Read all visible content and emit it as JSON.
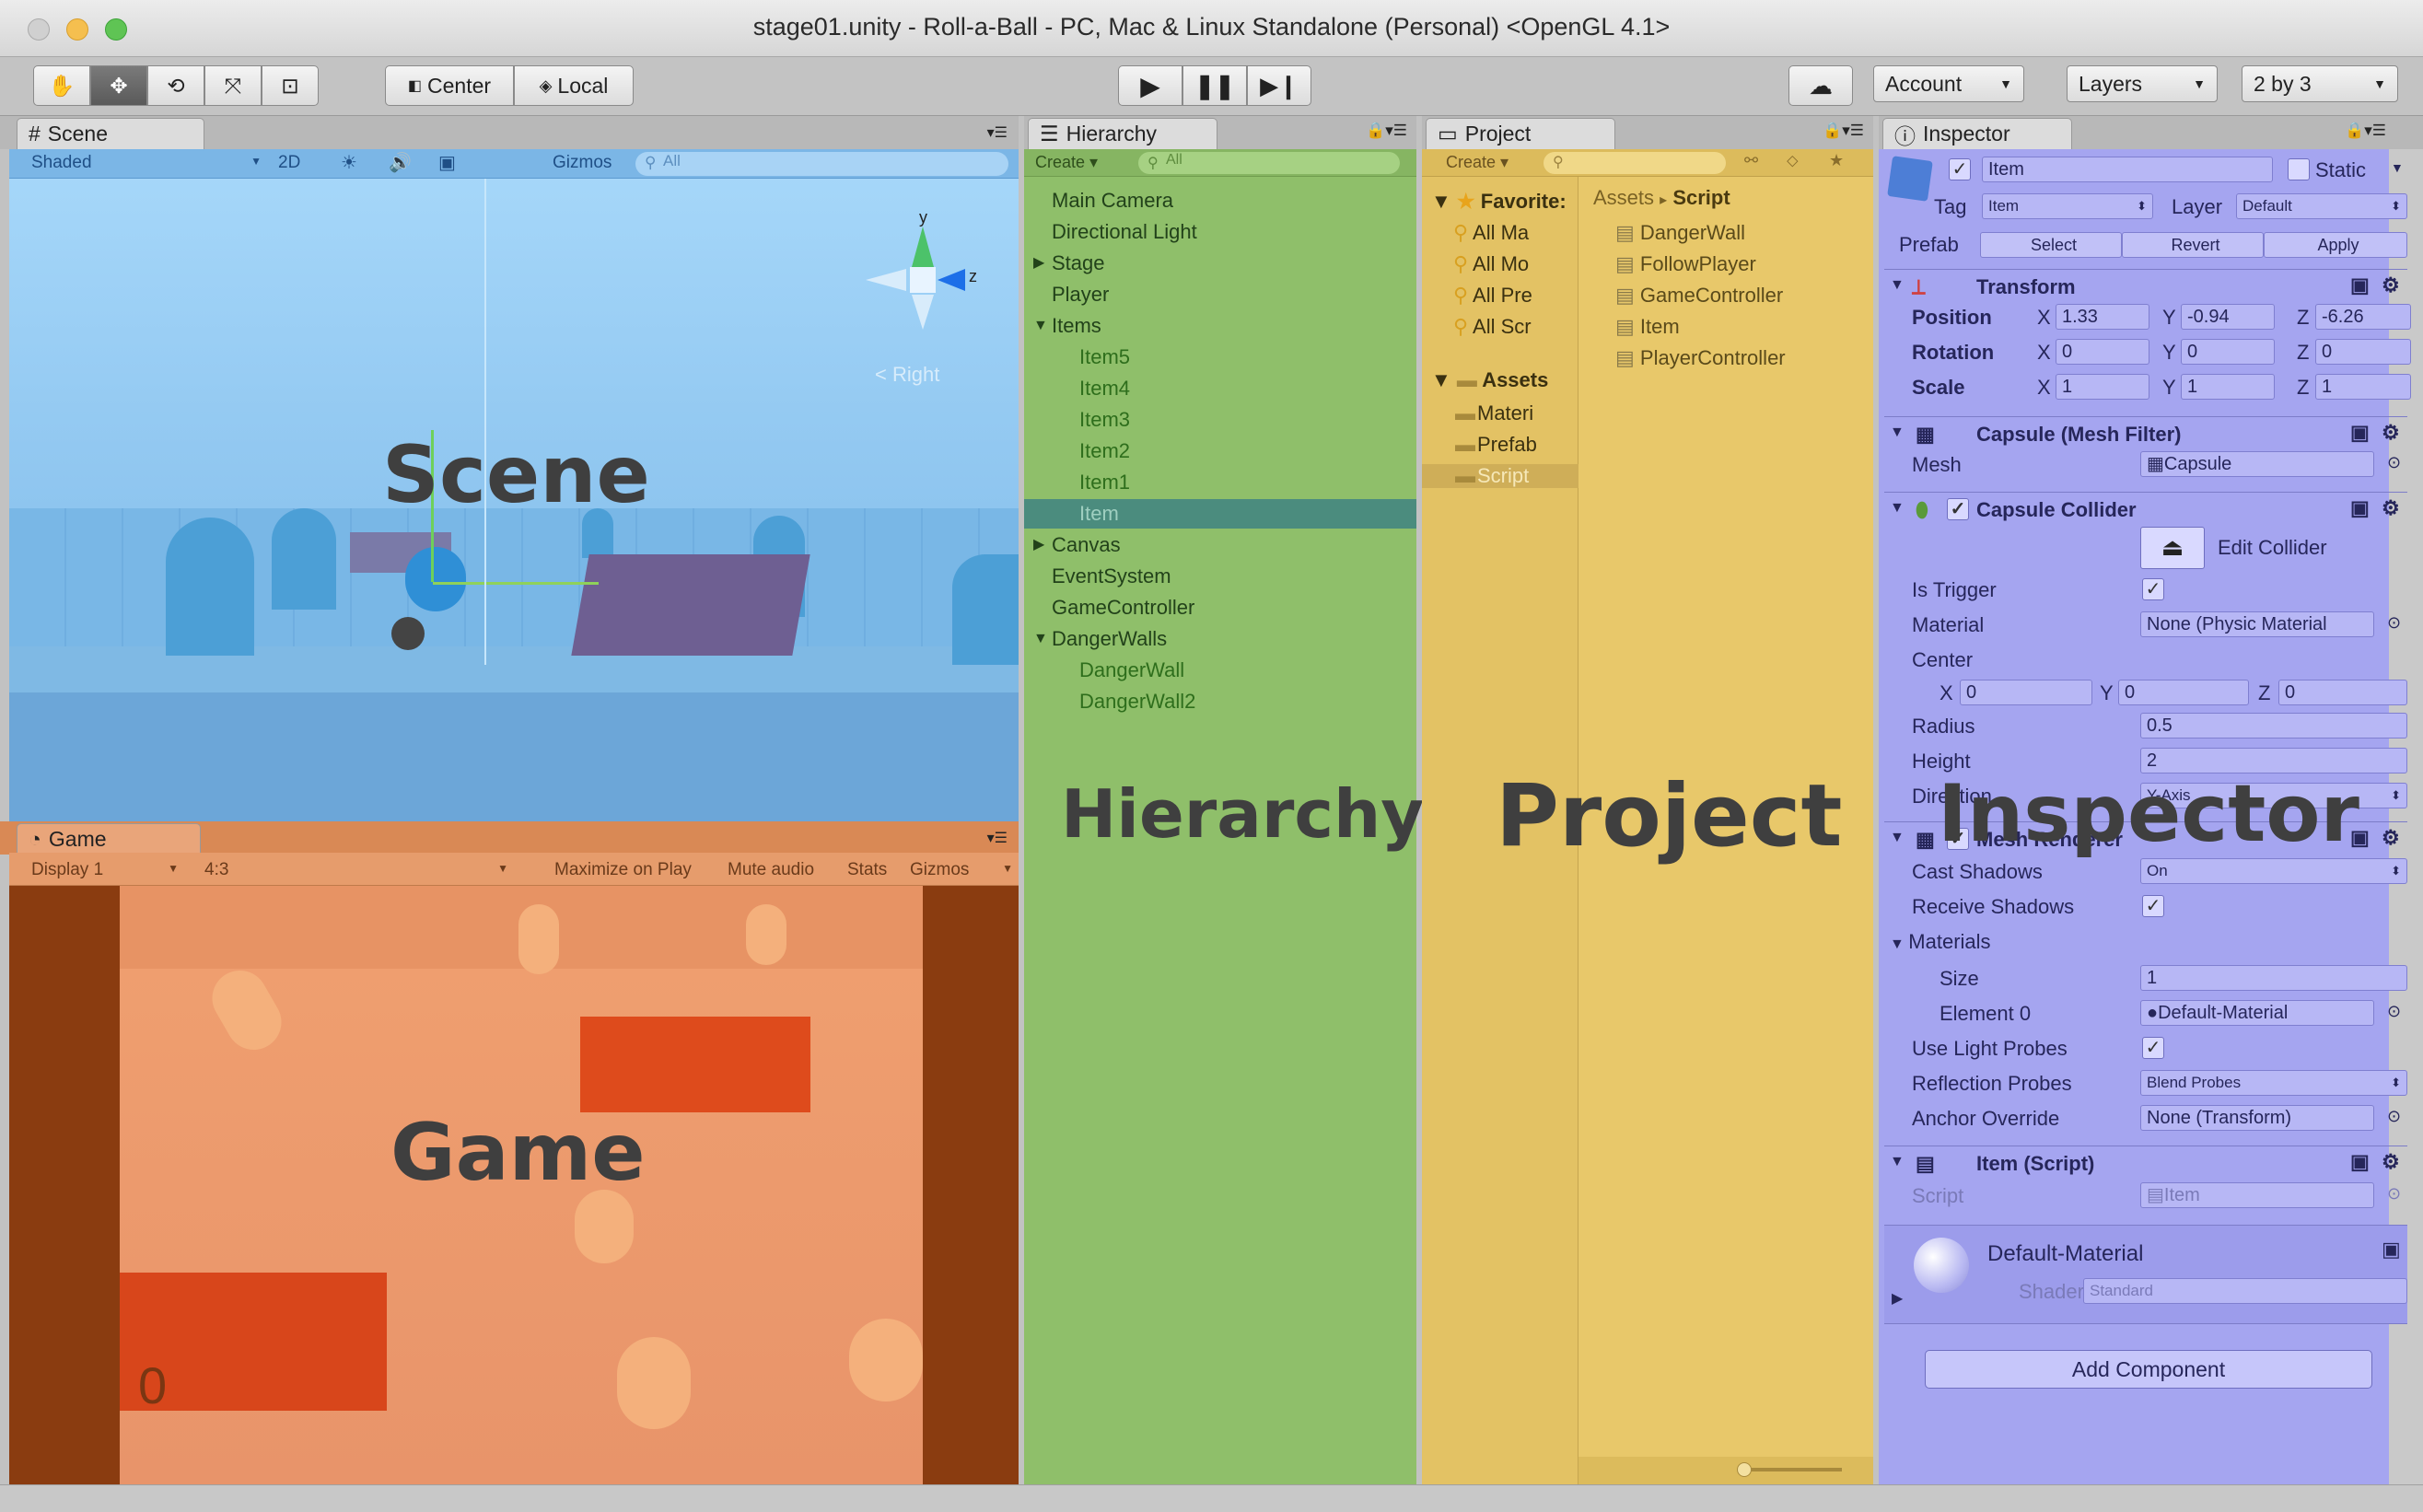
{
  "window": {
    "title": "stage01.unity - Roll-a-Ball - PC, Mac & Linux Standalone (Personal) <OpenGL 4.1>"
  },
  "toolbar": {
    "pivot_label": "Center",
    "space_label": "Local",
    "account_label": "Account",
    "layers_label": "Layers",
    "layout_label": "2 by 3"
  },
  "scene": {
    "tab_label": "Scene",
    "shading": "Shaded",
    "mode_2d": "2D",
    "gizmos": "Gizmos",
    "search_placeholder": "All",
    "gizmo_view": "< Right",
    "axis_y": "y",
    "axis_z": "z",
    "overlay_label": "Scene"
  },
  "game": {
    "tab_label": "Game",
    "display": "Display 1",
    "aspect": "4:3",
    "maximize": "Maximize on Play",
    "mute": "Mute audio",
    "stats": "Stats",
    "gizmos": "Gizmos",
    "score": "0",
    "overlay_label": "Game"
  },
  "hierarchy": {
    "tab_label": "Hierarchy",
    "create_label": "Create",
    "search_placeholder": "All",
    "overlay_label": "Hierarchy",
    "items": [
      {
        "label": "Main Camera",
        "indent": 0,
        "arrow": ""
      },
      {
        "label": "Directional Light",
        "indent": 0,
        "arrow": ""
      },
      {
        "label": "Stage",
        "indent": 0,
        "arrow": "▶"
      },
      {
        "label": "Player",
        "indent": 0,
        "arrow": ""
      },
      {
        "label": "Items",
        "indent": 0,
        "arrow": "▼"
      },
      {
        "label": "Item5",
        "indent": 1,
        "arrow": ""
      },
      {
        "label": "Item4",
        "indent": 1,
        "arrow": ""
      },
      {
        "label": "Item3",
        "indent": 1,
        "arrow": ""
      },
      {
        "label": "Item2",
        "indent": 1,
        "arrow": ""
      },
      {
        "label": "Item1",
        "indent": 1,
        "arrow": ""
      },
      {
        "label": "Item",
        "indent": 1,
        "arrow": "",
        "selected": true
      },
      {
        "label": "Canvas",
        "indent": 0,
        "arrow": "▶"
      },
      {
        "label": "EventSystem",
        "indent": 0,
        "arrow": ""
      },
      {
        "label": "GameController",
        "indent": 0,
        "arrow": ""
      },
      {
        "label": "DangerWalls",
        "indent": 0,
        "arrow": "▼"
      },
      {
        "label": "DangerWall",
        "indent": 1,
        "arrow": ""
      },
      {
        "label": "DangerWall2",
        "indent": 1,
        "arrow": ""
      }
    ]
  },
  "project": {
    "tab_label": "Project",
    "create_label": "Create",
    "overlay_label": "Project",
    "favorites_label": "Favorite:",
    "favorites": [
      "All Ma",
      "All Mo",
      "All Pre",
      "All Scr"
    ],
    "assets_label": "Assets",
    "asset_folders": [
      "Materi",
      "Prefab",
      "Script"
    ],
    "breadcrumb": [
      "Assets",
      "Script"
    ],
    "breadcrumb_sep": "▸",
    "files": [
      "DangerWall",
      "FollowPlayer",
      "GameController",
      "Item",
      "PlayerController"
    ]
  },
  "inspector": {
    "tab_label": "Inspector",
    "overlay_label": "Inspector",
    "object_name": "Item",
    "static_label": "Static",
    "tag_label": "Tag",
    "tag_value": "Item",
    "layer_label": "Layer",
    "layer_value": "Default",
    "prefab_label": "Prefab",
    "prefab_select": "Select",
    "prefab_revert": "Revert",
    "prefab_apply": "Apply",
    "transform": {
      "header": "Transform",
      "position_label": "Position",
      "pos_x": "1.33",
      "pos_y": "-0.94",
      "pos_z": "-6.26",
      "rotation_label": "Rotation",
      "rot_x": "0",
      "rot_y": "0",
      "rot_z": "0",
      "scale_label": "Scale",
      "scl_x": "1",
      "scl_y": "1",
      "scl_z": "1",
      "x": "X",
      "y": "Y",
      "z": "Z"
    },
    "mesh_filter": {
      "header": "Capsule (Mesh Filter)",
      "mesh_label": "Mesh",
      "mesh_value": "Capsule"
    },
    "collider": {
      "header": "Capsule Collider",
      "edit_label": "Edit Collider",
      "trigger_label": "Is Trigger",
      "material_label": "Material",
      "material_value": "None (Physic Material",
      "center_label": "Center",
      "cx": "0",
      "cy": "0",
      "cz": "0",
      "radius_label": "Radius",
      "radius_value": "0.5",
      "height_label": "Height",
      "height_value": "2",
      "direction_label": "Direction",
      "direction_value": "Y-Axis"
    },
    "mesh_renderer": {
      "header": "Mesh Renderer",
      "cast_label": "Cast Shadows",
      "cast_value": "On",
      "receive_label": "Receive Shadows",
      "materials_label": "Materials",
      "size_label": "Size",
      "size_value": "1",
      "element_label": "Element 0",
      "element_value": "Default-Material",
      "probes_label": "Use Light Probes",
      "reflection_label": "Reflection Probes",
      "reflection_value": "Blend Probes",
      "anchor_label": "Anchor Override",
      "anchor_value": "None (Transform)"
    },
    "script": {
      "header": "Item (Script)",
      "script_label": "Script",
      "script_value": "Item"
    },
    "material": {
      "name": "Default-Material",
      "shader_label": "Shader",
      "shader_value": "Standard"
    },
    "add_component": "Add Component"
  },
  "colors": {
    "scene_tint": "#6ab0e6",
    "game_tint": "#e89a6a",
    "hierarchy_tint": "#8fc06a",
    "project_tint": "#e8c86a",
    "inspector_tint": "#a5a5f0"
  }
}
